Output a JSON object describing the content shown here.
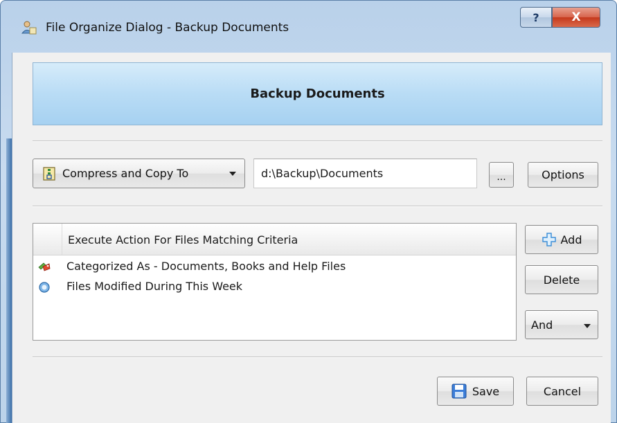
{
  "window": {
    "title": "File Organize Dialog - Backup Documents",
    "help_label": "?",
    "close_label": "X"
  },
  "header": {
    "title": "Backup Documents"
  },
  "action": {
    "dropdown_label": "Compress and Copy To",
    "dropdown_icon": "archive-copy-icon",
    "path_value": "d:\\Backup\\Documents",
    "browse_label": "...",
    "options_label": "Options"
  },
  "criteria": {
    "column_header": "Execute Action For Files Matching Criteria",
    "items": [
      {
        "label": "Categorized As - Documents, Books and Help Files",
        "icon": "category-tags-icon"
      },
      {
        "label": "Files Modified During This Week",
        "icon": "date-modified-icon"
      }
    ],
    "add_label": "Add",
    "delete_label": "Delete",
    "operator_label": "And"
  },
  "footer": {
    "save_label": "Save",
    "cancel_label": "Cancel"
  },
  "colors": {
    "header_gradient": "#b9dcf5",
    "close_button": "#c5391c",
    "accent_blue": "#3d6fa8"
  }
}
